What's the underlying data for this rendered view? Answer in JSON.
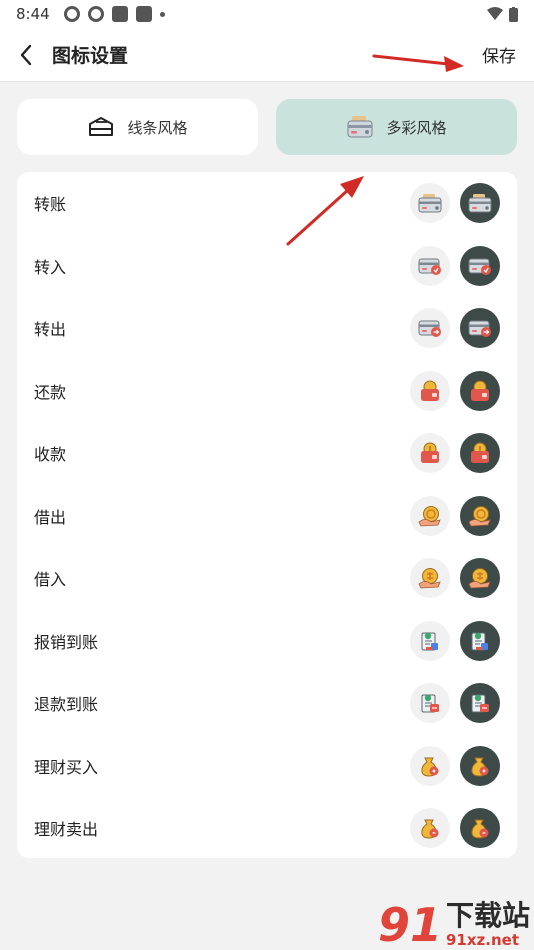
{
  "status_bar": {
    "time": "8:44"
  },
  "header": {
    "title": "图标设置",
    "save_label": "保存"
  },
  "style_options": [
    {
      "label": "线条风格",
      "icon": "line-style-icon",
      "selected": false
    },
    {
      "label": "多彩风格",
      "icon": "colorful-style-icon",
      "selected": true
    }
  ],
  "rows": [
    {
      "label": "转账",
      "icon": "transfer-card-icon"
    },
    {
      "label": "转入",
      "icon": "card-in-icon"
    },
    {
      "label": "转出",
      "icon": "card-out-icon"
    },
    {
      "label": "还款",
      "icon": "repay-bag-icon"
    },
    {
      "label": "收款",
      "icon": "receive-bag-icon"
    },
    {
      "label": "借出",
      "icon": "lend-coin-icon"
    },
    {
      "label": "借入",
      "icon": "borrow-coin-icon"
    },
    {
      "label": "报销到账",
      "icon": "reimburse-icon"
    },
    {
      "label": "退款到账",
      "icon": "refund-icon"
    },
    {
      "label": "理财买入",
      "icon": "invest-buy-icon"
    },
    {
      "label": "理财卖出",
      "icon": "invest-sell-icon"
    }
  ],
  "colors": {
    "selected_bg": "#c9e3dc",
    "dark_circle": "#3e4a48",
    "light_circle": "#f1f1f1",
    "arrow": "#d22b25"
  },
  "watermark": {
    "logo": "91",
    "main": "下载站",
    "url": "91xz.net"
  }
}
